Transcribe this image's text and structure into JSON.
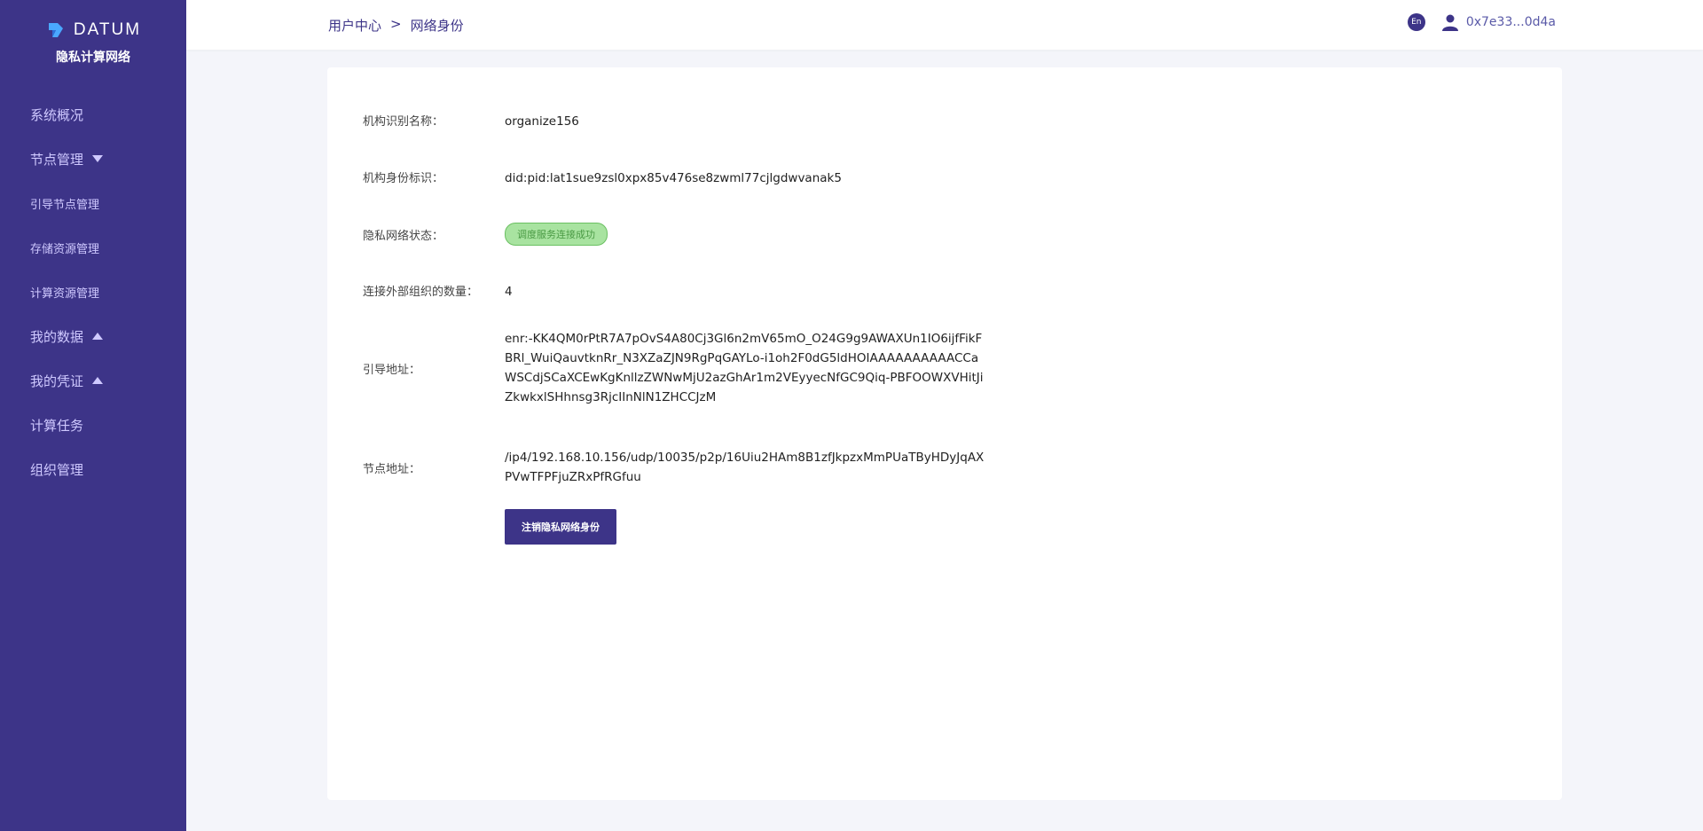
{
  "brand": {
    "name": "DATUM",
    "subtitle": "隐私计算网络",
    "accent": "#3d3488"
  },
  "sidebar": {
    "items": [
      {
        "label": "系统概况"
      },
      {
        "label": "节点管理"
      },
      {
        "label": "引导节点管理"
      },
      {
        "label": "存储资源管理"
      },
      {
        "label": "计算资源管理"
      },
      {
        "label": "我的数据"
      },
      {
        "label": "我的凭证"
      },
      {
        "label": "计算任务"
      },
      {
        "label": "组织管理"
      }
    ]
  },
  "header": {
    "breadcrumb": {
      "parent": "用户中心",
      "separator": ">",
      "current": "网络身份"
    },
    "lang": "En",
    "user_address": "0x7e33...0d4a"
  },
  "identity": {
    "org_name_label": "机构识别名称：",
    "org_name": "organize156",
    "org_id_label": "机构身份标识：",
    "org_id": "did:pid:lat1sue9zsl0xpx85v476se8zwml77cjlgdwvanak5",
    "network_status_label": "隐私网络状态：",
    "network_status": "调度服务连接成功",
    "external_orgs_label": "连接外部组织的数量：",
    "external_orgs": "4",
    "bootstrap_label": "引导地址：",
    "bootstrap_address": "enr:-KK4QM0rPtR7A7pOvS4A80Cj3Gl6n2mV65mO_O24G9g9AWAXUn1IO6ijfFikFBRl_WuiQauvtknRr_N3XZaZJN9RgPqGAYLo-i1oh2F0dG5ldHOIAAAAAAAAAACCaWSCdjSCaXCEwKgKnllzZWNwMjU2azGhAr1m2VEyyecNfGC9Qiq-PBFOOWXVHitJiZkwkxlSHhnsg3RjcIInNlN1ZHCCJzM",
    "node_label": "节点地址：",
    "node_address": "/ip4/192.168.10.156/udp/10035/p2p/16Uiu2HAm8B1zfJkpzxMmPUaTByHDyJqAXPVwTFPFjuZRxPfRGfuu",
    "revoke_button": "注销隐私网络身份"
  }
}
